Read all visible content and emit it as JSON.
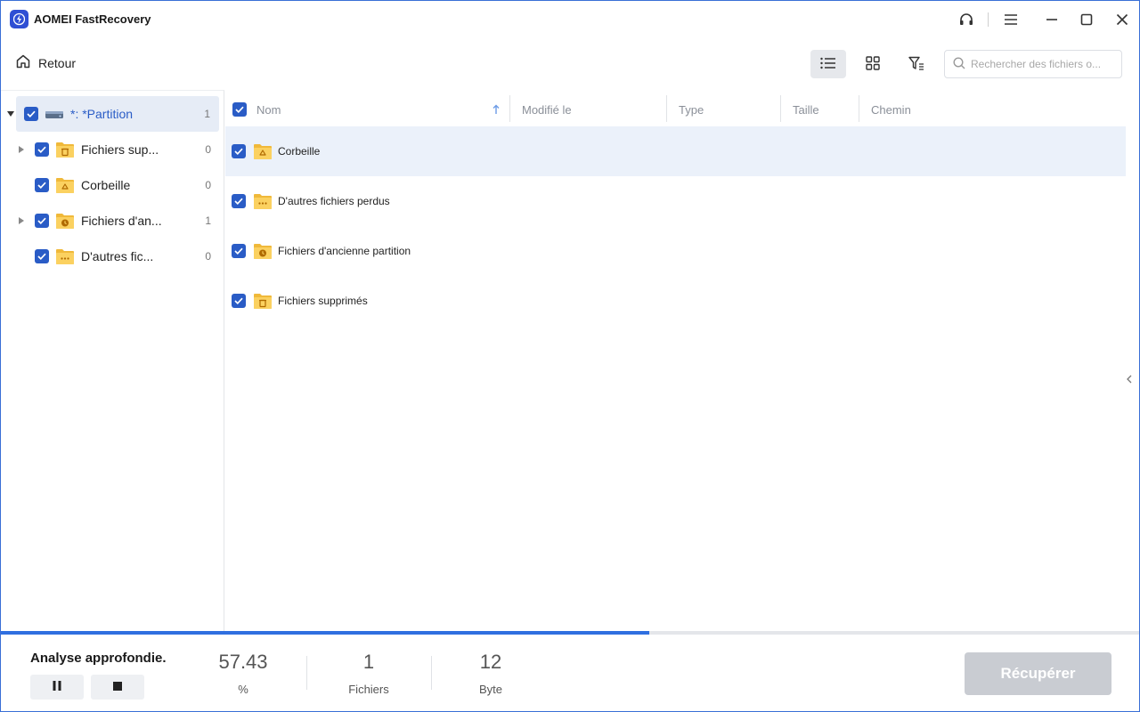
{
  "app": {
    "title": "AOMEI FastRecovery",
    "logo_icon": "lightning-icon",
    "accent": "#2a5cc6"
  },
  "toolbar": {
    "back_label": "Retour",
    "search_placeholder": "Rechercher des fichiers o..."
  },
  "tree": {
    "root": {
      "label": "*: *Partition",
      "count": "1"
    },
    "items": [
      {
        "label": "Fichiers sup...",
        "count": "0",
        "icon": "trash-folder-icon",
        "expandable": true
      },
      {
        "label": "Corbeille",
        "count": "0",
        "icon": "recycle-folder-icon",
        "expandable": false
      },
      {
        "label": "Fichiers d'an...",
        "count": "1",
        "icon": "clock-folder-icon",
        "expandable": true
      },
      {
        "label": "D'autres fic...",
        "count": "0",
        "icon": "dots-folder-icon",
        "expandable": false
      }
    ]
  },
  "table": {
    "columns": [
      "Nom",
      "Modifié le",
      "Type",
      "Taille",
      "Chemin"
    ],
    "rows": [
      {
        "name": "Corbeille",
        "icon": "recycle-folder-icon"
      },
      {
        "name": "D'autres fichiers perdus",
        "icon": "dots-folder-icon"
      },
      {
        "name": "Fichiers d'ancienne partition",
        "icon": "clock-folder-icon"
      },
      {
        "name": "Fichiers supprimés",
        "icon": "trash-folder-icon"
      }
    ]
  },
  "scan": {
    "title": "Analyse approfondie.",
    "progress_fraction": 0.57,
    "percent_value": "57.43",
    "percent_unit": "%",
    "files_value": "1",
    "files_unit": "Fichiers",
    "size_value": "12",
    "size_unit": "Byte"
  },
  "recover_label": "Récupérer"
}
